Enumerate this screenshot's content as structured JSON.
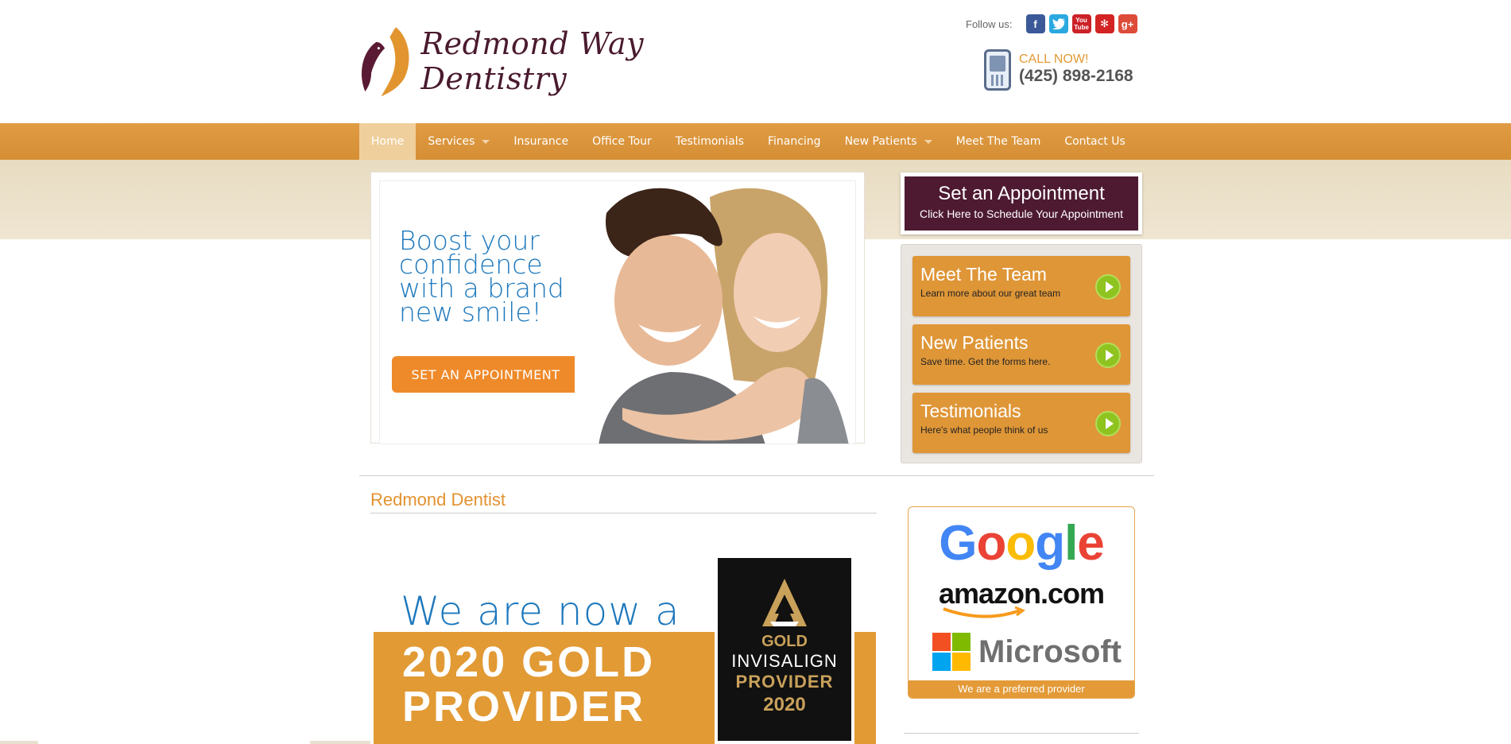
{
  "header": {
    "site_name": "Redmond Way Dentistry",
    "follow_label": "Follow us:",
    "social": [
      {
        "name": "facebook",
        "glyph": "f",
        "color": "#3b5998"
      },
      {
        "name": "twitter",
        "glyph": "t",
        "color": "#2aa9e0"
      },
      {
        "name": "youtube",
        "glyph": "You Tube",
        "color": "#cc2127"
      },
      {
        "name": "yelp",
        "glyph": "*",
        "color": "#d32323"
      },
      {
        "name": "google-plus",
        "glyph": "g+",
        "color": "#dd4b39"
      }
    ],
    "call_now": "CALL NOW!",
    "phone": "(425) 898-2168"
  },
  "nav": {
    "items": [
      {
        "label": "Home",
        "active": true,
        "dropdown": false
      },
      {
        "label": "Services",
        "active": false,
        "dropdown": true
      },
      {
        "label": "Insurance",
        "active": false,
        "dropdown": false
      },
      {
        "label": "Office Tour",
        "active": false,
        "dropdown": false
      },
      {
        "label": "Testimonials",
        "active": false,
        "dropdown": false
      },
      {
        "label": "Financing",
        "active": false,
        "dropdown": false
      },
      {
        "label": "New Patients",
        "active": false,
        "dropdown": true
      },
      {
        "label": "Meet The Team",
        "active": false,
        "dropdown": false
      },
      {
        "label": "Contact Us",
        "active": false,
        "dropdown": false
      }
    ]
  },
  "hero": {
    "headline": "Boost your confidence with a brand new smile!",
    "button": "SET AN APPOINTMENT"
  },
  "appointment": {
    "title": "Set an Appointment",
    "subtitle": "Click Here to Schedule Your Appointment"
  },
  "quick_links": [
    {
      "title": "Meet The Team",
      "subtitle": "Learn more about our great team"
    },
    {
      "title": "New Patients",
      "subtitle": "Save time. Get the forms here."
    },
    {
      "title": "Testimonials",
      "subtitle": "Here's what people think of us"
    }
  ],
  "main": {
    "heading": "Redmond Dentist",
    "promo_line1": "We are now a",
    "promo_line2": "2020 GOLD",
    "promo_line3": "PROVIDER",
    "badge": {
      "t1": "GOLD",
      "t2": "INVISALIGN",
      "t3": "PROVIDER",
      "t4": "2020"
    }
  },
  "preferred": {
    "google": "Google",
    "amazon": "amazon.com",
    "microsoft": "Microsoft",
    "caption": "We are a preferred provider"
  },
  "colors": {
    "brand_orange": "#db953b",
    "brand_plum": "#4e1a32",
    "hero_blue": "#1d78bd",
    "play_green": "#8fc31f"
  }
}
